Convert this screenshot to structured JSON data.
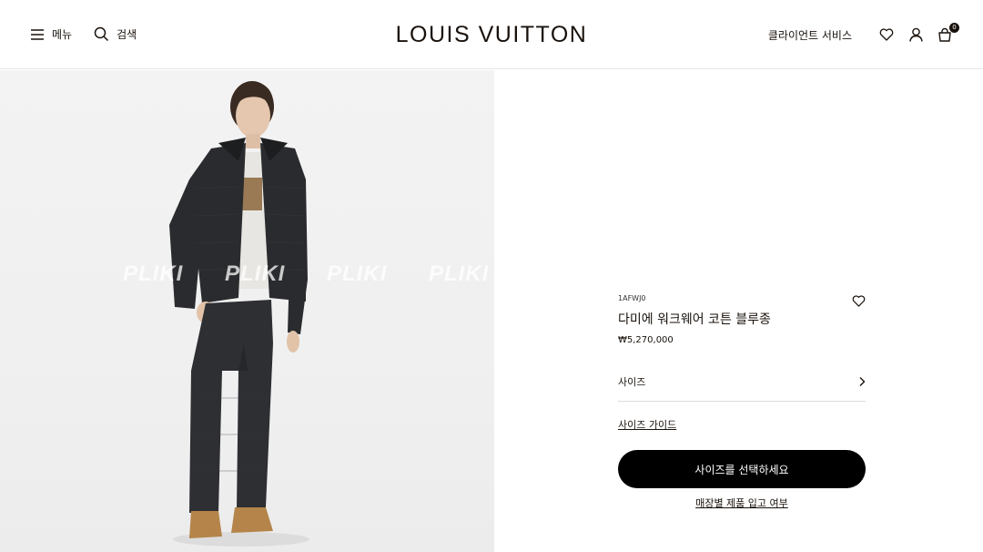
{
  "header": {
    "menu_label": "메뉴",
    "search_label": "검색",
    "logo": "LOUIS VUITTON",
    "client_service": "클라이언트 서비스",
    "cart_count": "0"
  },
  "gallery": {
    "watermark": "PLIKI PLIKI PLIKI PLIKI PLIKI"
  },
  "product": {
    "sku": "1AFWJ0",
    "name": "다미에 워크웨어 코튼 블루종",
    "price": "₩5,270,000",
    "size_label": "사이즈",
    "size_guide": "사이즈 가이드",
    "cta": "사이즈를 선택하세요",
    "store_stock": "매장별 제품 입고 여부"
  },
  "colors": {
    "ink": "#19110b",
    "cta_bg": "#000000",
    "photo_bg": "#f0f0f0"
  }
}
